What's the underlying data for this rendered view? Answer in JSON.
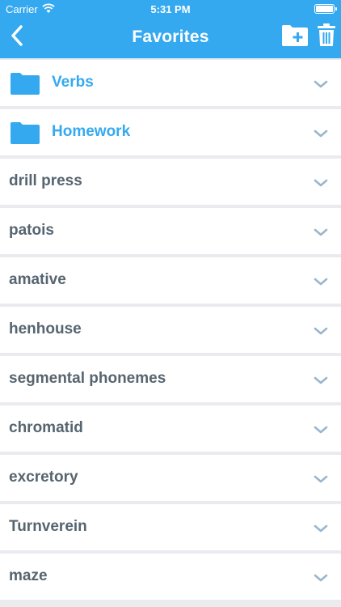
{
  "status_bar": {
    "carrier": "Carrier",
    "time": "5:31 PM"
  },
  "header": {
    "title": "Favorites"
  },
  "colors": {
    "accent": "#35a9ef",
    "item_text": "#566570",
    "chevron": "#9ab6cc",
    "background": "#e9ebee"
  },
  "icons": {
    "back": "chevron-left-icon",
    "new_folder": "folder-plus-icon",
    "delete": "trash-icon",
    "folder": "folder-icon",
    "expand": "chevron-down-icon"
  },
  "folders": [
    {
      "label": "Verbs"
    },
    {
      "label": "Homework"
    }
  ],
  "items": [
    {
      "label": "drill press"
    },
    {
      "label": "patois"
    },
    {
      "label": "amative"
    },
    {
      "label": "henhouse"
    },
    {
      "label": "segmental phonemes"
    },
    {
      "label": "chromatid"
    },
    {
      "label": "excretory"
    },
    {
      "label": "Turnverein"
    },
    {
      "label": "maze"
    }
  ]
}
